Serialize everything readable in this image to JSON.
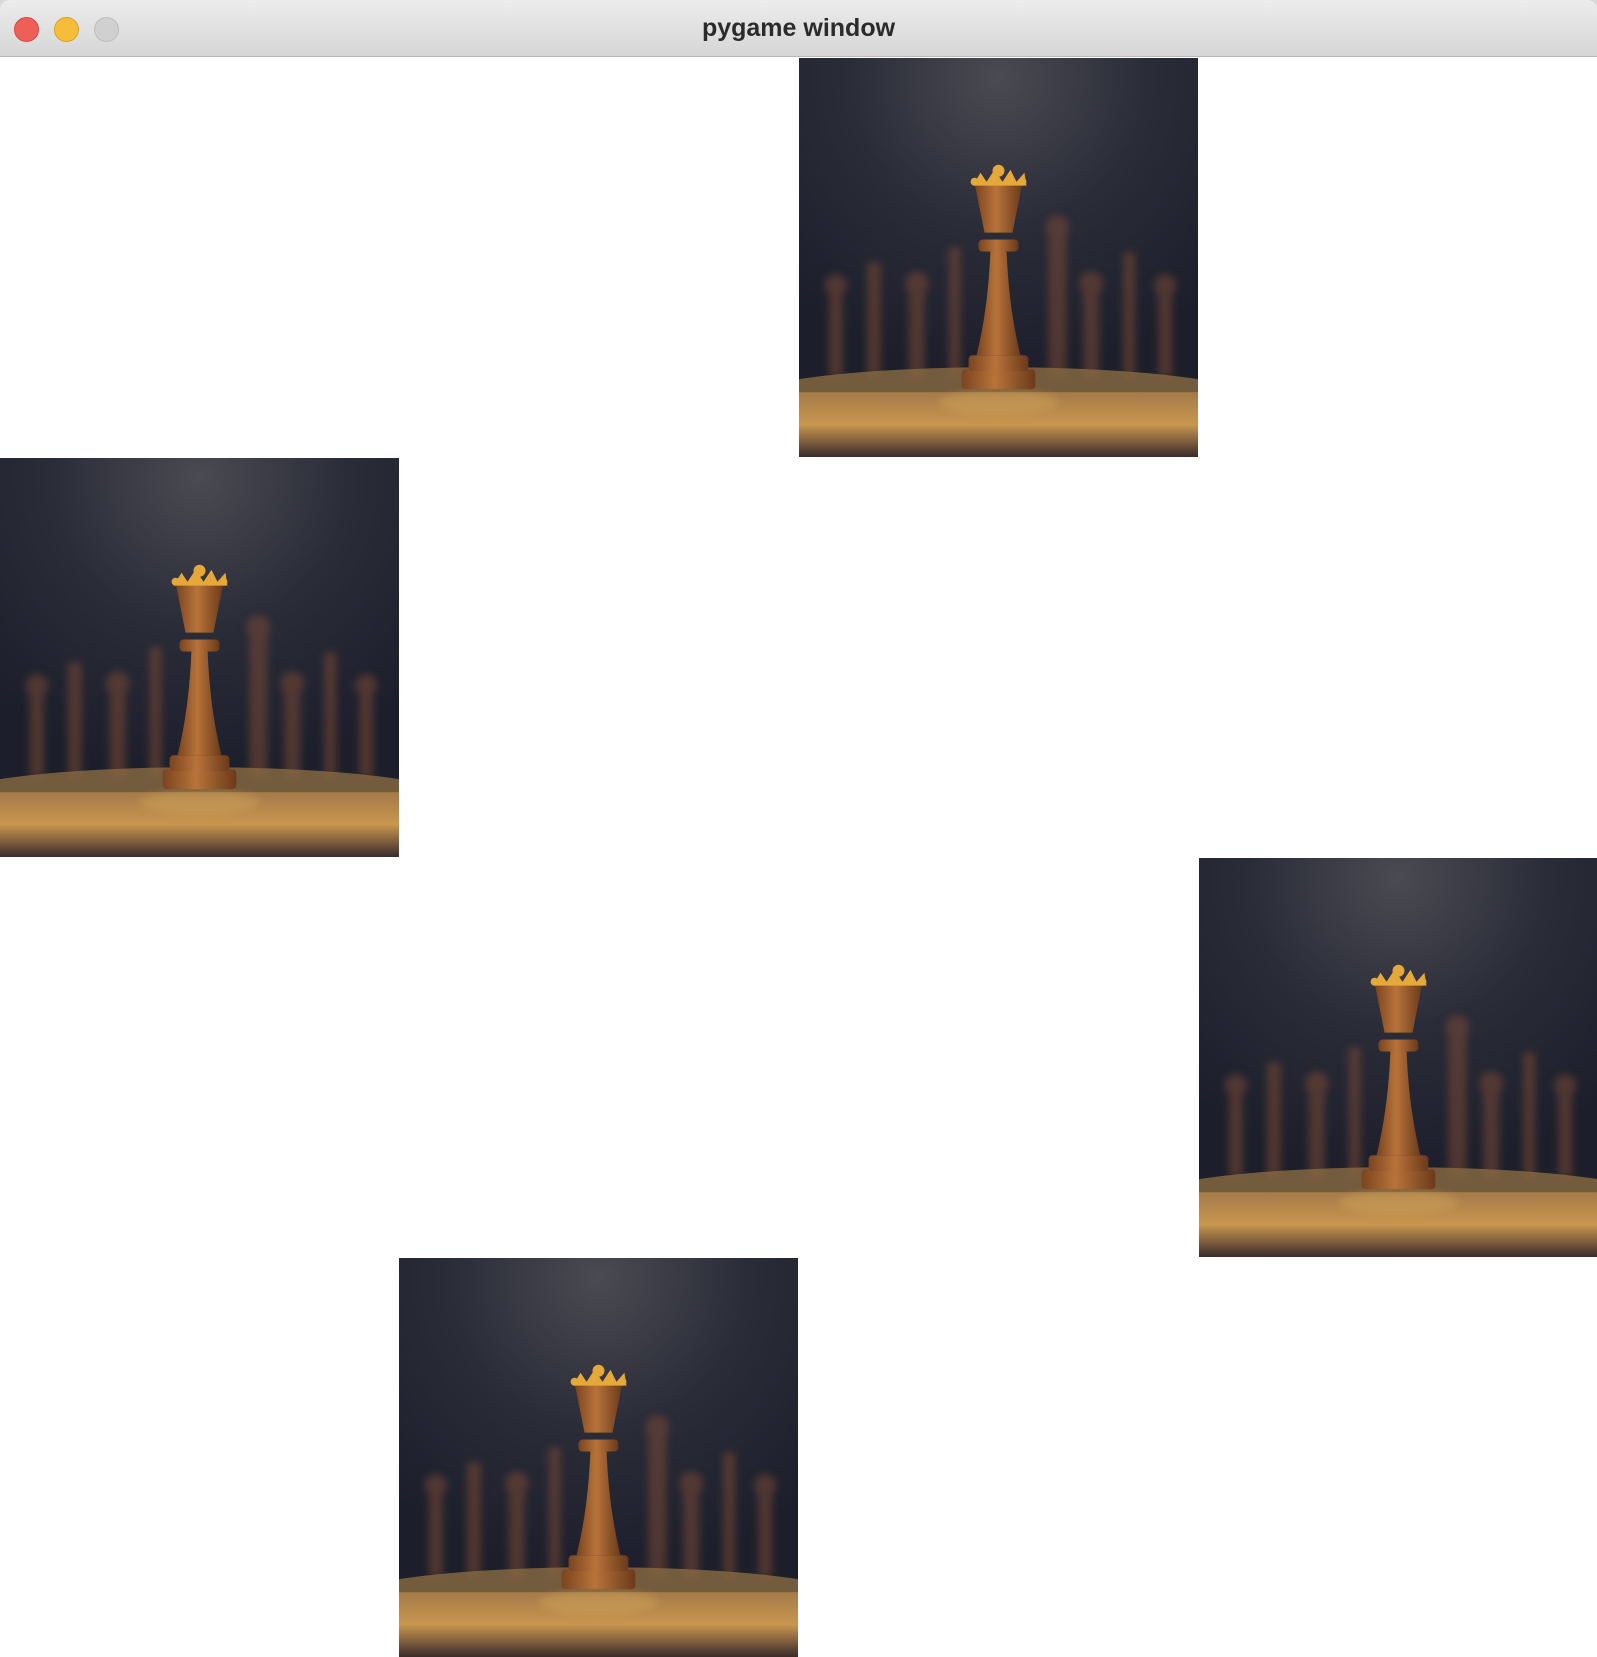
{
  "window": {
    "title": "pygame window"
  },
  "canvas": {
    "background": "#ffffff",
    "sprites": [
      {
        "name": "queen-chess-piece-image"
      },
      {
        "name": "queen-chess-piece-image"
      },
      {
        "name": "queen-chess-piece-image"
      },
      {
        "name": "queen-chess-piece-image"
      }
    ]
  },
  "colors": {
    "close": "#ee5f57",
    "minimize": "#f6bd3b",
    "zoom": "#d0d0d0",
    "sprite_background": "#1c1f2b",
    "piece_wood": "#b8733a"
  }
}
